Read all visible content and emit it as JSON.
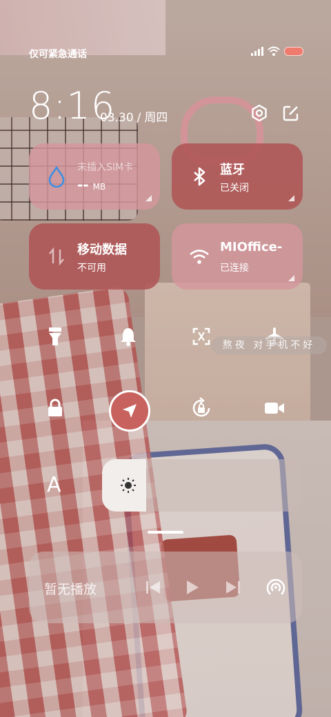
{
  "status_bar": {
    "carrier_text": "仅可紧急通话",
    "icons": [
      "signal-icon",
      "wifi-icon",
      "battery-icon"
    ],
    "battery_color": "#ef7a6e"
  },
  "header": {
    "time": "8:16",
    "date": "03.30",
    "separator": "/",
    "weekday": "周四",
    "icons": [
      "settings-icon",
      "edit-icon"
    ]
  },
  "tiles": {
    "sim": {
      "title": "未插入SIM卡",
      "value": "--",
      "unit": "MB",
      "icon": "water-drop-icon"
    },
    "bluetooth": {
      "title": "蓝牙",
      "status": "已关闭",
      "icon": "bluetooth-icon"
    },
    "mobile_data": {
      "title": "移动数据",
      "status": "不可用",
      "icon": "data-arrows-icon"
    },
    "wifi": {
      "title": "MIOffice-",
      "status": "已连接",
      "icon": "wifi-icon"
    }
  },
  "toggles": [
    {
      "name": "flashlight",
      "icon": "flashlight-icon",
      "active": false
    },
    {
      "name": "ringer",
      "icon": "bell-icon",
      "active": false
    },
    {
      "name": "screenshot",
      "icon": "screenshot-icon",
      "active": false
    },
    {
      "name": "airplane",
      "icon": "airplane-icon",
      "active": false
    },
    {
      "name": "lock",
      "icon": "lock-icon",
      "active": false
    },
    {
      "name": "location",
      "icon": "location-arrow-icon",
      "active": true
    },
    {
      "name": "rotation-lock",
      "icon": "rotation-lock-icon",
      "active": false
    },
    {
      "name": "screen-record",
      "icon": "video-camera-icon",
      "active": false
    }
  ],
  "overlay_text": "熬夜 对手机不好",
  "brightness": {
    "level": 0.22,
    "icon": "sun-icon"
  },
  "font_toggle": {
    "label": "A"
  },
  "media": {
    "now_playing": "暂无播放",
    "controls": [
      "previous-icon",
      "play-icon",
      "next-icon"
    ],
    "cast_icon": "cast-icon"
  },
  "colors": {
    "tile_off": "#d4969c",
    "tile_dark": "#af5555",
    "active_toggle": "#c8625e"
  }
}
